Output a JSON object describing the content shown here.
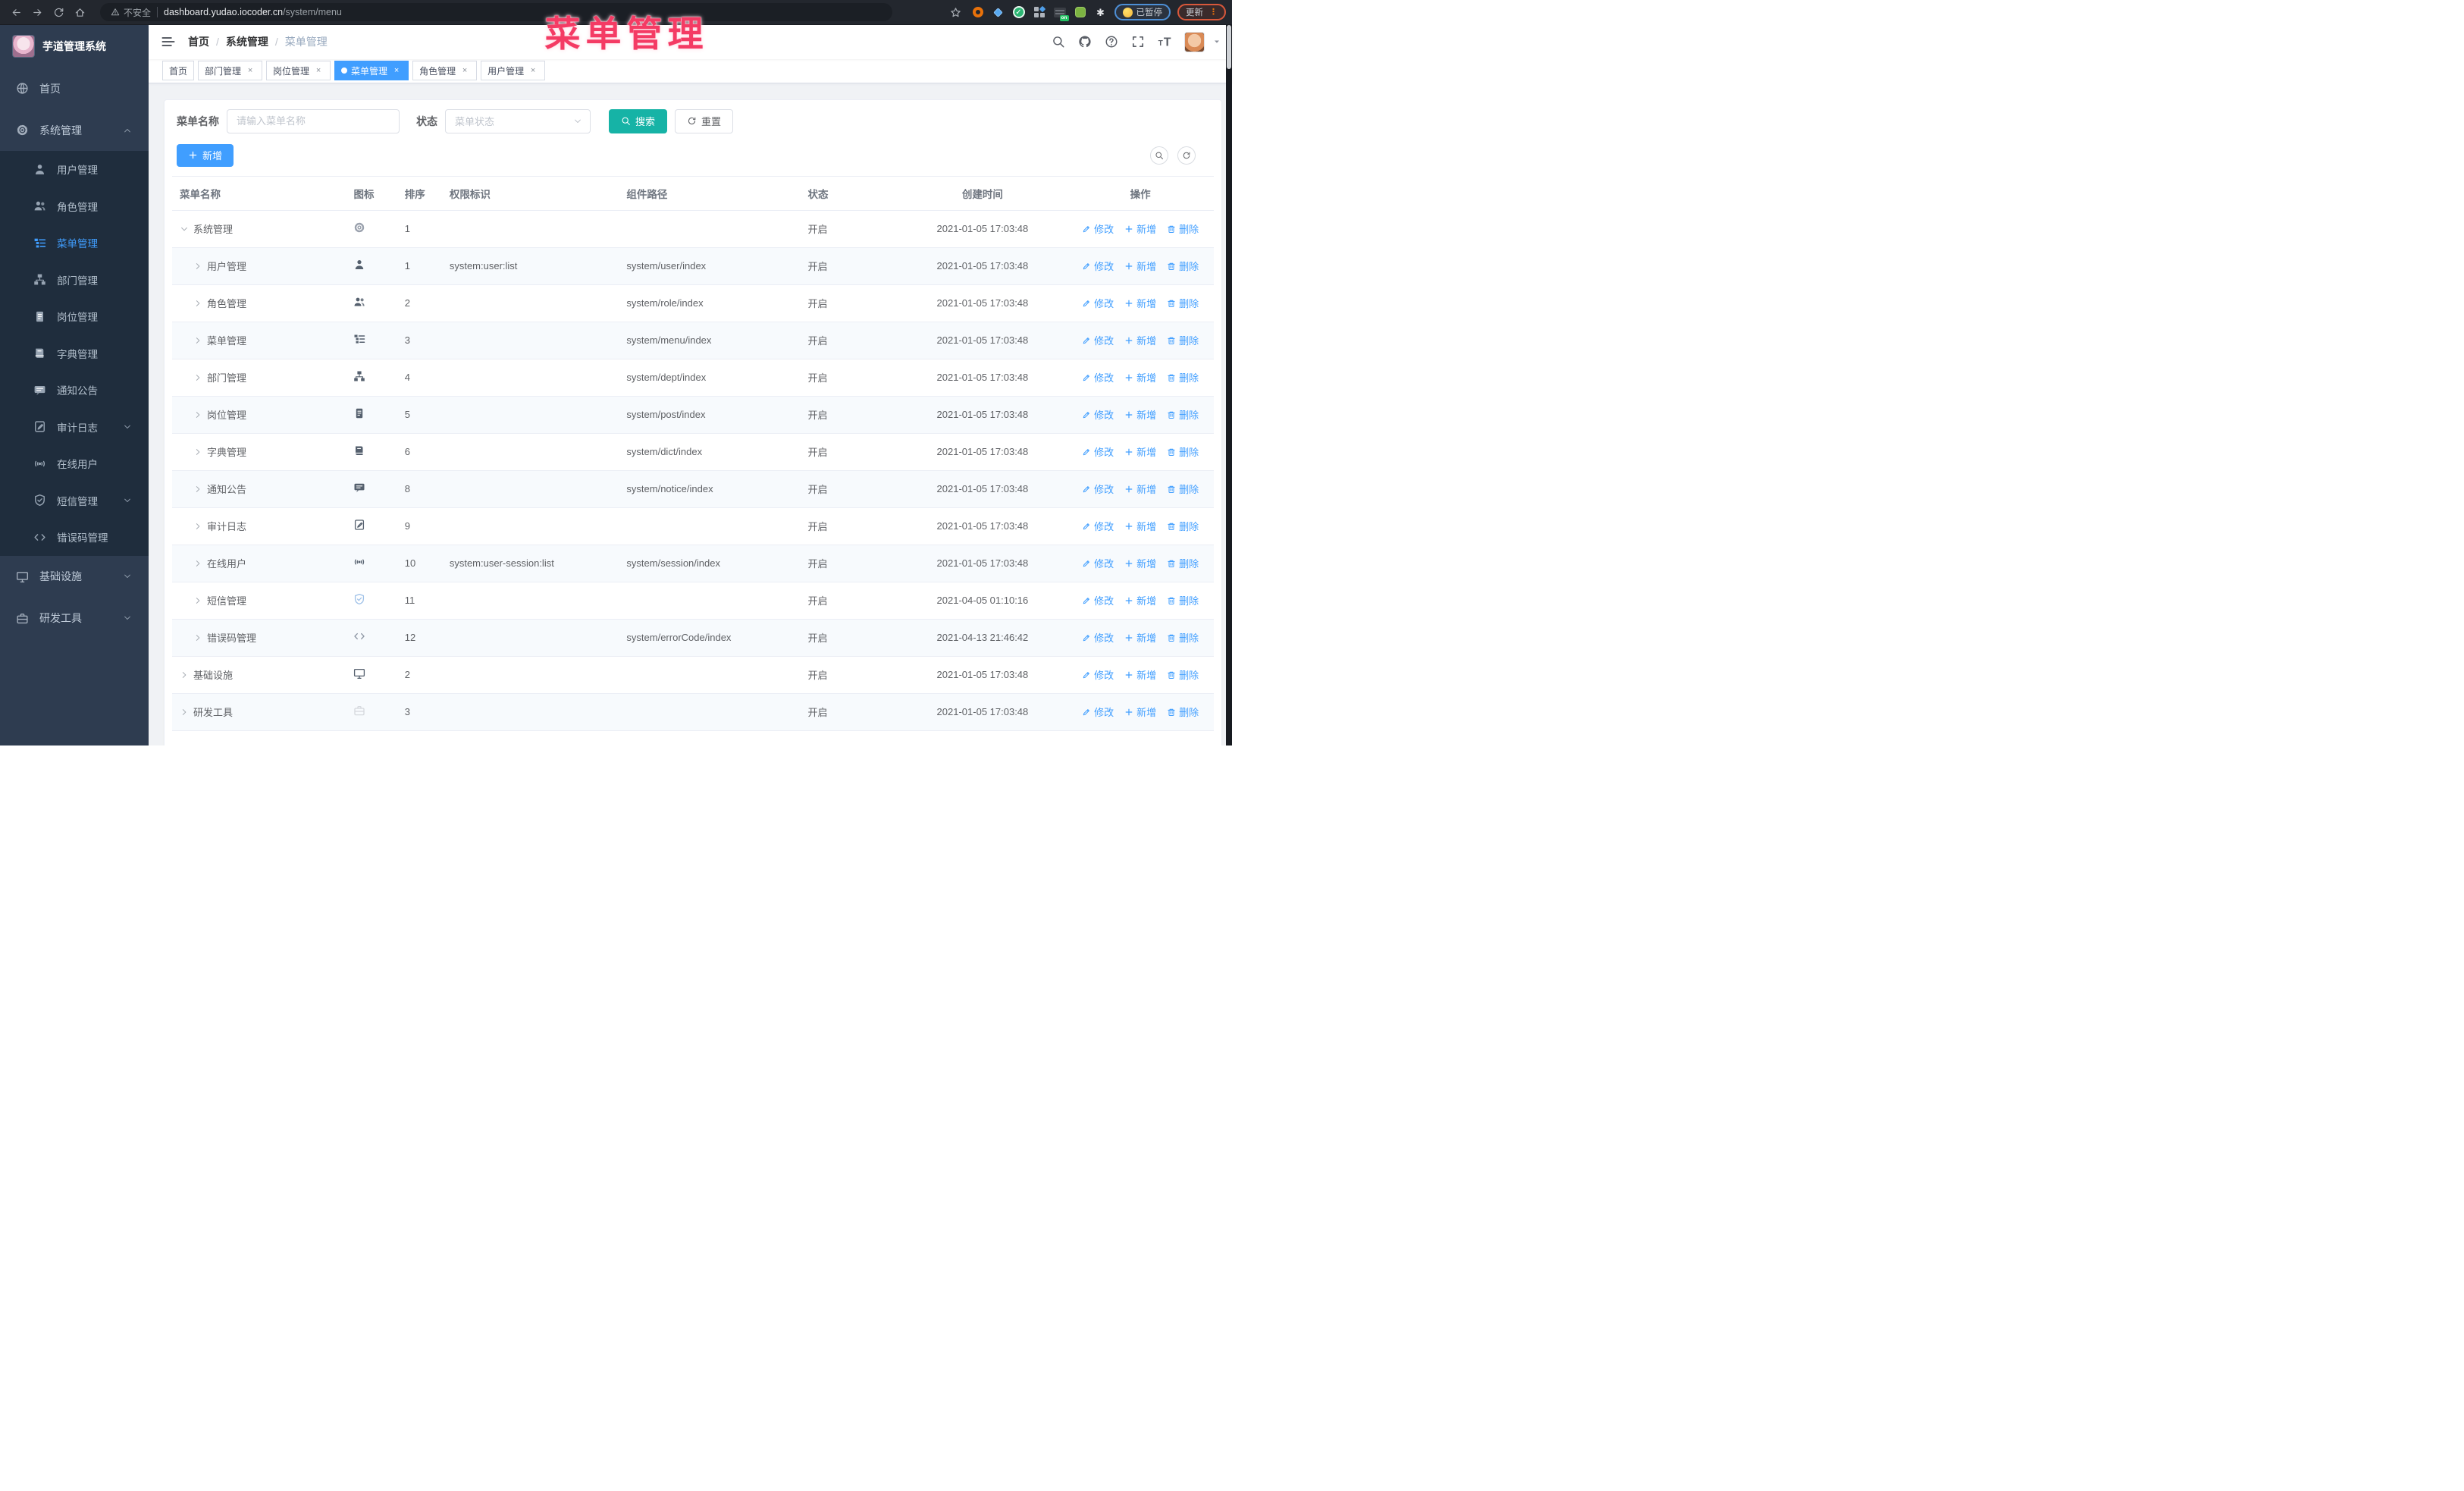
{
  "browser": {
    "security_label": "不安全",
    "url_domain": "dashboard.yudao.iocoder.cn",
    "url_path": "/system/menu",
    "paused_label": "已暂停",
    "update_label": "更新",
    "update_menu_glyph": "⋮"
  },
  "watermark": {
    "text": "菜单管理"
  },
  "sidebar": {
    "app_title": "芋道管理系统",
    "items": [
      {
        "key": "home",
        "label": "首页",
        "icon": "dashboard-icon",
        "type": "root"
      },
      {
        "key": "system",
        "label": "系统管理",
        "icon": "gear-icon",
        "type": "root",
        "arrow": "up"
      },
      {
        "key": "user",
        "label": "用户管理",
        "icon": "user-icon",
        "type": "sub"
      },
      {
        "key": "role",
        "label": "角色管理",
        "icon": "users-icon",
        "type": "sub"
      },
      {
        "key": "menu",
        "label": "菜单管理",
        "icon": "tree-table-icon",
        "type": "sub",
        "active": true
      },
      {
        "key": "dept",
        "label": "部门管理",
        "icon": "tree-icon",
        "type": "sub"
      },
      {
        "key": "post",
        "label": "岗位管理",
        "icon": "post-icon",
        "type": "sub"
      },
      {
        "key": "dict",
        "label": "字典管理",
        "icon": "dict-icon",
        "type": "sub"
      },
      {
        "key": "notice",
        "label": "通知公告",
        "icon": "message-icon",
        "type": "sub"
      },
      {
        "key": "audit",
        "label": "审计日志",
        "icon": "log-icon",
        "type": "sub",
        "arrow": "down"
      },
      {
        "key": "online",
        "label": "在线用户",
        "icon": "online-icon",
        "type": "sub"
      },
      {
        "key": "sms",
        "label": "短信管理",
        "icon": "shield-icon",
        "type": "sub",
        "arrow": "down"
      },
      {
        "key": "errcode",
        "label": "错误码管理",
        "icon": "code-icon",
        "type": "sub"
      },
      {
        "key": "infra",
        "label": "基础设施",
        "icon": "monitor-icon",
        "type": "root",
        "arrow": "down"
      },
      {
        "key": "devtool",
        "label": "研发工具",
        "icon": "tool-icon",
        "type": "root",
        "arrow": "down"
      }
    ]
  },
  "header": {
    "breadcrumb": [
      "首页",
      "系统管理",
      "菜单管理"
    ]
  },
  "tabs": [
    {
      "label": "首页",
      "closable": false,
      "active": false
    },
    {
      "label": "部门管理",
      "closable": true,
      "active": false
    },
    {
      "label": "岗位管理",
      "closable": true,
      "active": false
    },
    {
      "label": "菜单管理",
      "closable": true,
      "active": true
    },
    {
      "label": "角色管理",
      "closable": true,
      "active": false
    },
    {
      "label": "用户管理",
      "closable": true,
      "active": false
    }
  ],
  "search": {
    "name_label": "菜单名称",
    "name_placeholder": "请输入菜单名称",
    "name_value": "",
    "status_label": "状态",
    "status_placeholder": "菜单状态",
    "search_label": "搜索",
    "reset_label": "重置"
  },
  "toolbar": {
    "add_label": "新增"
  },
  "table": {
    "columns": [
      "菜单名称",
      "图标",
      "排序",
      "权限标识",
      "组件路径",
      "状态",
      "创建时间",
      "操作"
    ],
    "actions": {
      "edit": "修改",
      "add": "新增",
      "delete": "删除"
    },
    "rows": [
      {
        "name": "系统管理",
        "level": "parent",
        "expanded": true,
        "icon": "gear-icon",
        "icon_color": "#9aa1ad",
        "sort": "1",
        "perm": "",
        "path": "",
        "status": "开启",
        "time": "2021-01-05 17:03:48"
      },
      {
        "name": "用户管理",
        "level": "child",
        "expanded": false,
        "icon": "user-icon",
        "icon_color": "#55606e",
        "sort": "1",
        "perm": "system:user:list",
        "path": "system/user/index",
        "status": "开启",
        "time": "2021-01-05 17:03:48"
      },
      {
        "name": "角色管理",
        "level": "child",
        "expanded": false,
        "icon": "users-icon",
        "icon_color": "#55606e",
        "sort": "2",
        "perm": "",
        "path": "system/role/index",
        "status": "开启",
        "time": "2021-01-05 17:03:48"
      },
      {
        "name": "菜单管理",
        "level": "child",
        "expanded": false,
        "icon": "tree-table-icon",
        "icon_color": "#55606e",
        "sort": "3",
        "perm": "",
        "path": "system/menu/index",
        "status": "开启",
        "time": "2021-01-05 17:03:48"
      },
      {
        "name": "部门管理",
        "level": "child",
        "expanded": false,
        "icon": "tree-icon",
        "icon_color": "#55606e",
        "sort": "4",
        "perm": "",
        "path": "system/dept/index",
        "status": "开启",
        "time": "2021-01-05 17:03:48"
      },
      {
        "name": "岗位管理",
        "level": "child",
        "expanded": false,
        "icon": "post-icon",
        "icon_color": "#55606e",
        "sort": "5",
        "perm": "",
        "path": "system/post/index",
        "status": "开启",
        "time": "2021-01-05 17:03:48"
      },
      {
        "name": "字典管理",
        "level": "child",
        "expanded": false,
        "icon": "dict-icon",
        "icon_color": "#55606e",
        "sort": "6",
        "perm": "",
        "path": "system/dict/index",
        "status": "开启",
        "time": "2021-01-05 17:03:48"
      },
      {
        "name": "通知公告",
        "level": "child",
        "expanded": false,
        "icon": "message-icon",
        "icon_color": "#55606e",
        "sort": "8",
        "perm": "",
        "path": "system/notice/index",
        "status": "开启",
        "time": "2021-01-05 17:03:48"
      },
      {
        "name": "审计日志",
        "level": "child",
        "expanded": false,
        "icon": "log-icon",
        "icon_color": "#55606e",
        "sort": "9",
        "perm": "",
        "path": "",
        "status": "开启",
        "time": "2021-01-05 17:03:48"
      },
      {
        "name": "在线用户",
        "level": "child",
        "expanded": false,
        "icon": "online-icon",
        "icon_color": "#55606e",
        "sort": "10",
        "perm": "system:user-session:list",
        "path": "system/session/index",
        "status": "开启",
        "time": "2021-01-05 17:03:48"
      },
      {
        "name": "短信管理",
        "level": "child",
        "expanded": false,
        "icon": "shield-icon",
        "icon_color": "#9fc1e8",
        "sort": "11",
        "perm": "",
        "path": "",
        "status": "开启",
        "time": "2021-04-05 01:10:16"
      },
      {
        "name": "错误码管理",
        "level": "child",
        "expanded": false,
        "icon": "code-icon",
        "icon_color": "#8a93a1",
        "sort": "12",
        "perm": "",
        "path": "system/errorCode/index",
        "status": "开启",
        "time": "2021-04-13 21:46:42"
      },
      {
        "name": "基础设施",
        "level": "parent",
        "expanded": false,
        "icon": "monitor-icon",
        "icon_color": "#55606e",
        "sort": "2",
        "perm": "",
        "path": "",
        "status": "开启",
        "time": "2021-01-05 17:03:48"
      },
      {
        "name": "研发工具",
        "level": "parent",
        "expanded": false,
        "icon": "tool-icon",
        "icon_color": "#d5d8dd",
        "sort": "3",
        "perm": "",
        "path": "",
        "status": "开启",
        "time": "2021-01-05 17:03:48"
      }
    ]
  }
}
